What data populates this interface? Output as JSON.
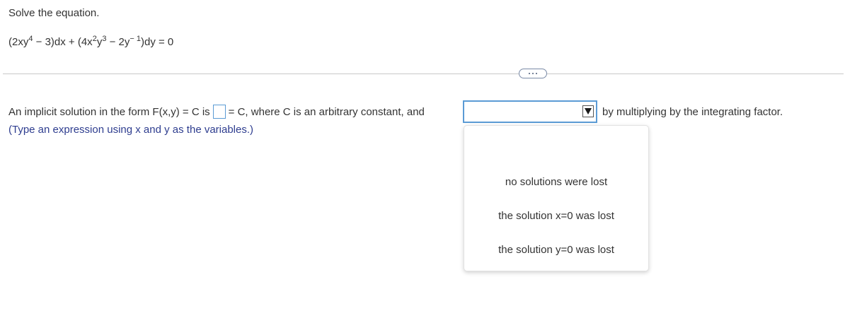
{
  "question": {
    "prompt": "Solve the equation.",
    "equation": {
      "p1": "(2xy",
      "e1": "4",
      "p2": " − 3)dx + (4x",
      "e2": "2",
      "p3": "y",
      "e3": "3",
      "p4": " − 2y",
      "e4": "− 1",
      "p5": ")dy = 0"
    }
  },
  "divider": {
    "expand_icon": "more-dots-icon"
  },
  "answer": {
    "text_before_box": "An implicit solution in the form F(x,y) = C is",
    "box_value": "",
    "text_after_box": "= C, where C is an arbitrary constant, and",
    "select_value": "",
    "text_after_select": "by multiplying by the integrating factor.",
    "hint": "(Type an expression using x and y as the variables.)"
  },
  "dropdown": {
    "arrow_icon": "triangle-down-icon",
    "options": [
      "no solutions were lost",
      "the solution x=0 was lost",
      "the solution y=0 was lost"
    ]
  },
  "colors": {
    "accent_border": "#5b9bd5",
    "hint_text": "#2e3d8f",
    "body_text": "#333333"
  }
}
